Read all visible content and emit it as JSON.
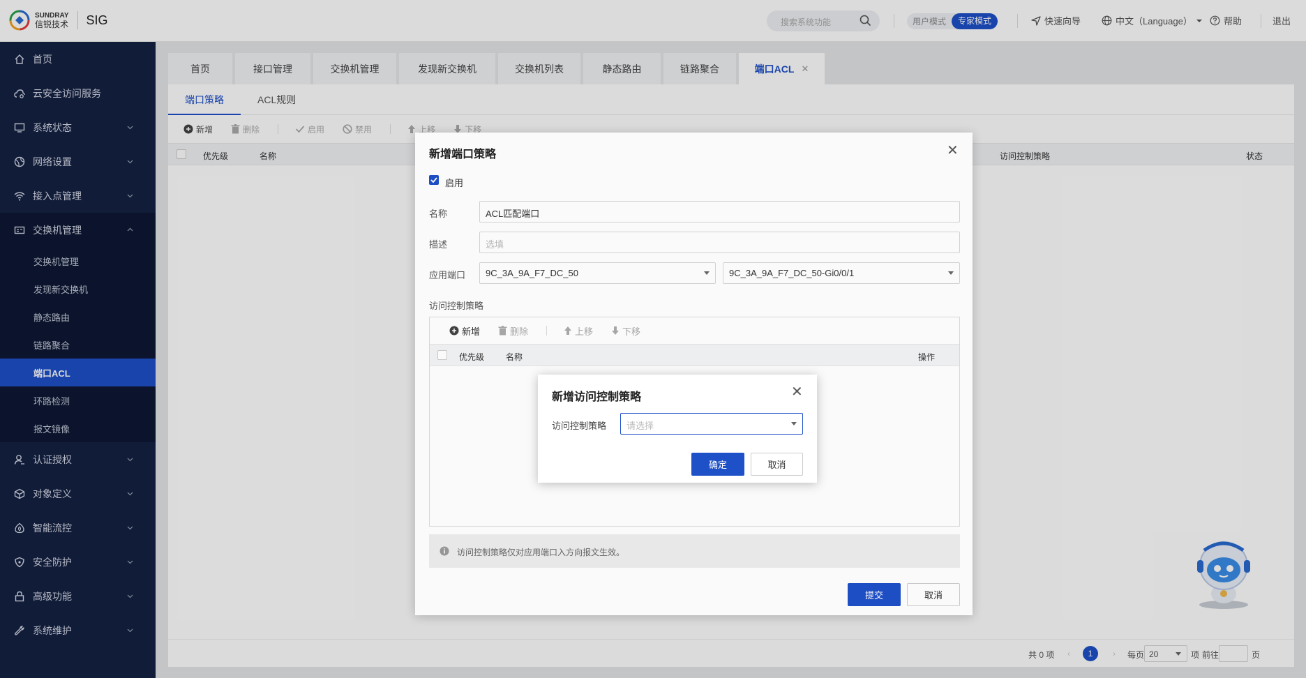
{
  "brand": {
    "en": "SUNDRAY",
    "cn": "信锐技术",
    "product": "SIG"
  },
  "header": {
    "search_placeholder": "搜索系统功能",
    "mode_user": "用户模式",
    "mode_expert": "专家模式",
    "quick_guide": "快速向导",
    "language": "中文（Language）",
    "help": "帮助",
    "logout": "退出"
  },
  "sidebar": {
    "items": [
      {
        "label": "首页",
        "icon": "home-icon"
      },
      {
        "label": "云安全访问服务",
        "icon": "cloud-icon"
      },
      {
        "label": "系统状态",
        "icon": "monitor-icon"
      },
      {
        "label": "网络设置",
        "icon": "globe-icon"
      },
      {
        "label": "接入点管理",
        "icon": "wifi-icon"
      },
      {
        "label": "交换机管理",
        "icon": "switch-icon"
      },
      {
        "label": "认证授权",
        "icon": "user-icon"
      },
      {
        "label": "对象定义",
        "icon": "cube-icon"
      },
      {
        "label": "智能流控",
        "icon": "flow-icon"
      },
      {
        "label": "安全防护",
        "icon": "shield-icon"
      },
      {
        "label": "高级功能",
        "icon": "lock-icon"
      },
      {
        "label": "系统维护",
        "icon": "wrench-icon"
      }
    ],
    "sub_items": [
      "交换机管理",
      "发现新交换机",
      "静态路由",
      "链路聚合",
      "端口ACL",
      "环路检测",
      "报文镜像"
    ]
  },
  "tabs": [
    "首页",
    "接口管理",
    "交换机管理",
    "发现新交换机",
    "交换机列表",
    "静态路由",
    "链路聚合",
    "端口ACL"
  ],
  "subtabs": [
    "端口策略",
    "ACL规则"
  ],
  "toolbar": {
    "add": "新增",
    "delete": "删除",
    "enable": "启用",
    "disable": "禁用",
    "up": "上移",
    "down": "下移"
  },
  "table": {
    "col_priority": "优先级",
    "col_name": "名称",
    "col_acl": "访问控制策略",
    "col_status": "状态"
  },
  "pager": {
    "total": "共 0 项",
    "page": "1",
    "per_page_label": "每页",
    "per_page": "20",
    "unit": "项",
    "goto": "前往",
    "page_unit": "页"
  },
  "dialog_port": {
    "title": "新增端口策略",
    "enable_label": "启用",
    "name_label": "名称",
    "name_value": "ACL匹配端口",
    "desc_label": "描述",
    "desc_placeholder": "选填",
    "port_label": "应用端口",
    "port_switch": "9C_3A_9A_F7_DC_50",
    "port_iface": "9C_3A_9A_F7_DC_50-Gi0/0/1",
    "acl_section": "访问控制策略",
    "inner_add": "新增",
    "inner_delete": "删除",
    "inner_up": "上移",
    "inner_down": "下移",
    "inner_col_priority": "优先级",
    "inner_col_name": "名称",
    "inner_col_op": "操作",
    "note": "访问控制策略仅对应用端口入方向报文生效。",
    "submit": "提交",
    "cancel": "取消"
  },
  "dialog_acl": {
    "title": "新增访问控制策略",
    "label": "访问控制策略",
    "placeholder": "请选择",
    "confirm": "确定",
    "cancel": "取消"
  },
  "colors": {
    "accent": "#1e50c8",
    "sidebar": "#152142",
    "sidebar_sub": "#0e1834"
  }
}
